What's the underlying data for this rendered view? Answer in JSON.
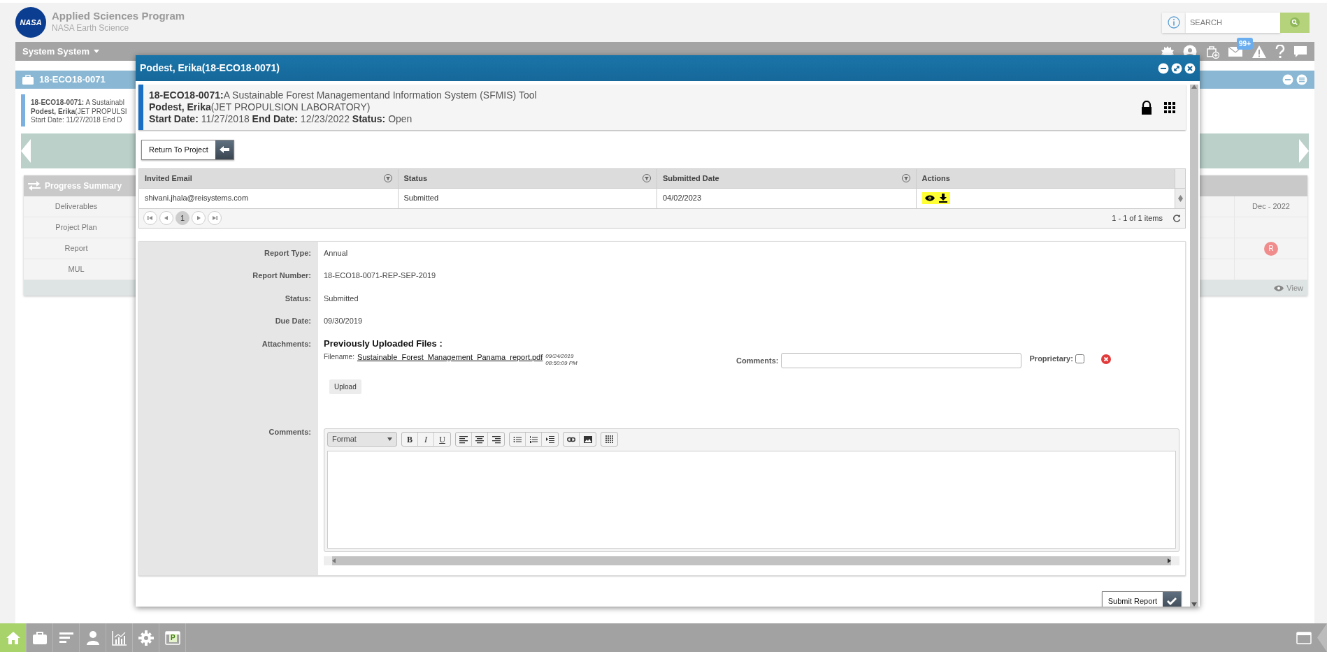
{
  "header": {
    "logo_text": "NASA",
    "title": "Applied Sciences Program",
    "subtitle": "NASA Earth Science",
    "search": {
      "placeholder": "SEARCH"
    }
  },
  "system_bar": {
    "user_menu": "System System",
    "mail_badge": "99+"
  },
  "project_panel": {
    "title": "18-ECO18-0071",
    "summary": [
      "**18-ECO18-0071:** A Sustainabl",
      "**Podest, Erika**(JET PROPULSI",
      "Start Date: 11/27/2018 End D"
    ]
  },
  "progress_summary": {
    "title": "Progress Summary",
    "period": "Dec - 2022",
    "rows": [
      {
        "label": "Deliverables"
      },
      {
        "label": "Project Plan"
      },
      {
        "label": "Report",
        "marker": "R"
      },
      {
        "label": "MUL"
      }
    ],
    "view_link": "View"
  },
  "modal": {
    "title": "Podest, Erika(18-ECO18-0071)",
    "project_lines": [
      "**18-ECO18-0071:**A Sustainable Forest Managementand Information System (SFMIS) Tool",
      "**Podest, Erika**(JET PROPULSION LABORATORY)",
      "**Start Date:** 11/27/2018  **End Date:** 12/23/2022  **Status:** Open"
    ],
    "return_button": "Return To Project",
    "grid": {
      "columns": [
        {
          "label": "Invited Email",
          "filter": true
        },
        {
          "label": "Status",
          "filter": true
        },
        {
          "label": "Submitted Date",
          "filter": true
        },
        {
          "label": "Actions",
          "filter": false
        }
      ],
      "rows": [
        {
          "cells": [
            "shivani.jhala@reisystems.com",
            "Submitted",
            "04/02/2023"
          ],
          "highlighted": true
        }
      ],
      "pages": [
        {
          "label": "1",
          "selected": true
        }
      ],
      "item_count": "1 - 1 of 1 items"
    },
    "fields": [
      {
        "label": "Report Type:",
        "value": "Annual"
      },
      {
        "label": "Report Number:",
        "value": "18-ECO18-0071-REP-SEP-2019"
      },
      {
        "label": "Status:",
        "value": "Submitted"
      },
      {
        "label": "Due Date:",
        "value": "09/30/2019"
      }
    ],
    "attachments": {
      "label": "Attachments:",
      "heading": "Previously Uploaded Files :",
      "files": [
        {
          "filename_label": "Filename:",
          "name": "Sustainable_Forest_Management_Panama_report.pdf",
          "timestamp": "09/24/2019 08:50:09 PM",
          "comments_label": "Comments:",
          "proprietary_label": "Proprietary:",
          "proprietary": false
        }
      ],
      "upload_button": "Upload"
    },
    "comments": {
      "label": "Comments:",
      "format_placeholder": "Format",
      "style_buttons": [
        "B",
        "I",
        "U"
      ]
    },
    "submit_button": "Submit Report"
  },
  "taskbar": {
    "items": [
      {
        "kind": "home",
        "selected": true
      },
      {
        "kind": "briefcase",
        "selected": false
      },
      {
        "kind": "reports",
        "selected": false
      },
      {
        "kind": "person",
        "selected": false
      },
      {
        "kind": "chart",
        "selected": false
      },
      {
        "kind": "gear",
        "selected": false
      },
      {
        "kind": "portal",
        "selected": false,
        "label": "P"
      }
    ]
  }
}
